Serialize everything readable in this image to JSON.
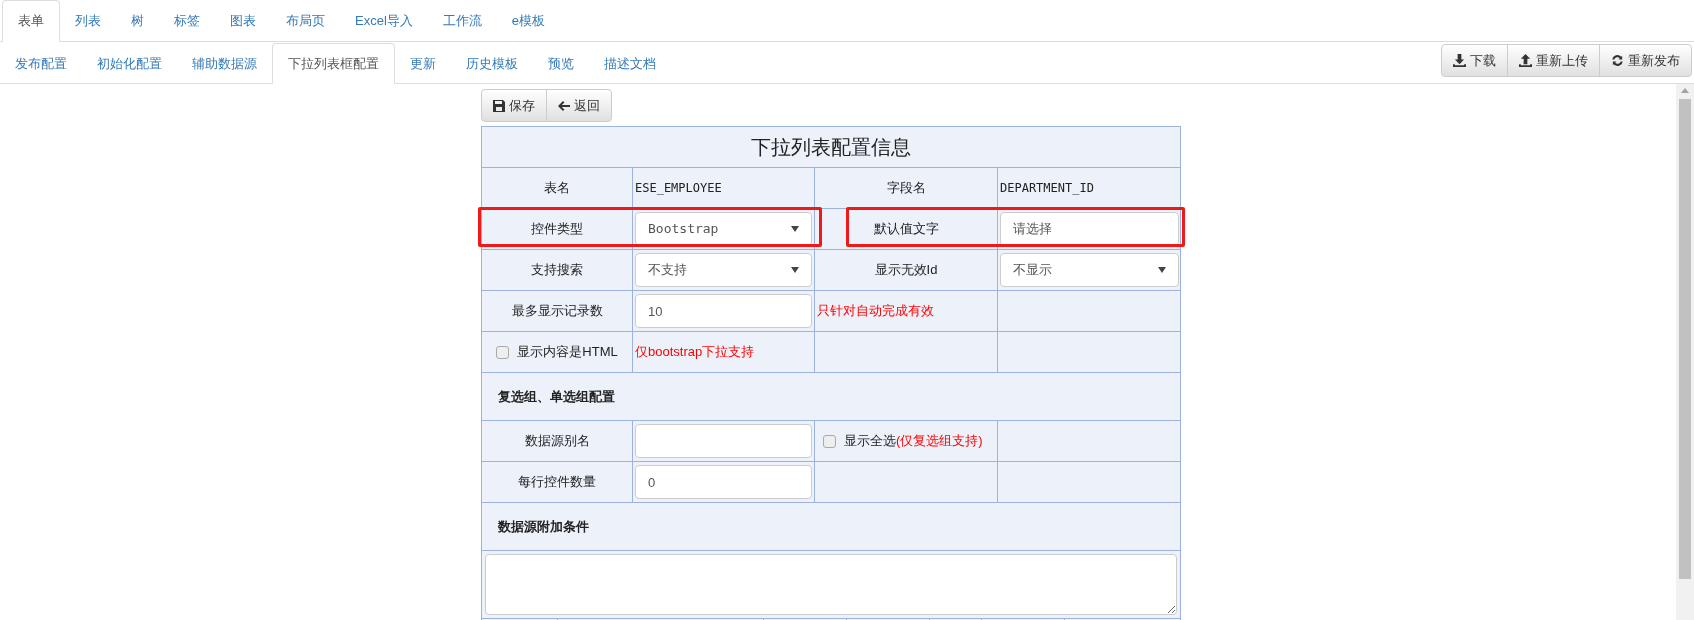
{
  "main_tabs": [
    {
      "label": "表单",
      "selected": true
    },
    {
      "label": "列表",
      "selected": false
    },
    {
      "label": "树",
      "selected": false
    },
    {
      "label": "标签",
      "selected": false
    },
    {
      "label": "图表",
      "selected": false
    },
    {
      "label": "布局页",
      "selected": false
    },
    {
      "label": "Excel导入",
      "selected": false
    },
    {
      "label": "工作流",
      "selected": false
    },
    {
      "label": "e模板",
      "selected": false
    }
  ],
  "sub_tabs": [
    {
      "label": "发布配置",
      "selected": false
    },
    {
      "label": "初始化配置",
      "selected": false
    },
    {
      "label": "辅助数据源",
      "selected": false
    },
    {
      "label": "下拉列表框配置",
      "selected": true
    },
    {
      "label": "更新",
      "selected": false
    },
    {
      "label": "历史模板",
      "selected": false
    },
    {
      "label": "预览",
      "selected": false
    },
    {
      "label": "描述文档",
      "selected": false
    }
  ],
  "toolbar": [
    {
      "kind": "download",
      "label": "下载"
    },
    {
      "kind": "upload",
      "label": "重新上传"
    },
    {
      "kind": "refresh",
      "label": "重新发布"
    }
  ],
  "form_buttons": [
    {
      "kind": "save",
      "label": "保存"
    },
    {
      "kind": "back",
      "label": "返回"
    }
  ],
  "form": {
    "title": "下拉列表配置信息",
    "rows": [
      {
        "kind": "cells",
        "cells": [
          {
            "kind": "label",
            "text": "表名"
          },
          {
            "kind": "text",
            "text": "ESE_EMPLOYEE"
          },
          {
            "kind": "label",
            "text": "字段名"
          },
          {
            "kind": "text",
            "text": "DEPARTMENT_ID"
          }
        ]
      },
      {
        "kind": "cells",
        "cells": [
          {
            "kind": "label",
            "text": "控件类型",
            "highlighted": true
          },
          {
            "kind": "select",
            "value": "Bootstrap"
          },
          {
            "kind": "label",
            "text": "默认值文字",
            "highlighted": true
          },
          {
            "kind": "input",
            "value": "请选择"
          }
        ]
      },
      {
        "kind": "cells",
        "cells": [
          {
            "kind": "label",
            "text": "支持搜索",
            "highlighted": false
          },
          {
            "kind": "select",
            "value": "不支持"
          },
          {
            "kind": "label",
            "text": "显示无效Id",
            "highlighted": false
          },
          {
            "kind": "select",
            "value": "不显示"
          }
        ]
      },
      {
        "kind": "cells",
        "cells": [
          {
            "kind": "label",
            "text": "最多显示记录数",
            "highlighted": false
          },
          {
            "kind": "input",
            "value": "10"
          },
          {
            "kind": "note",
            "text": "只针对自动完成有效"
          },
          {
            "kind": "empty"
          }
        ]
      },
      {
        "kind": "cells",
        "cells": [
          {
            "kind": "checkbox",
            "text": "显示内容是HTML",
            "checked": false
          },
          {
            "kind": "note",
            "text": "仅bootstrap下拉支持"
          },
          {
            "kind": "empty"
          },
          {
            "kind": "empty"
          }
        ]
      },
      {
        "kind": "section",
        "text": "复选组、单选组配置"
      },
      {
        "kind": "cells",
        "cells": [
          {
            "kind": "label",
            "text": "数据源别名",
            "highlighted": false
          },
          {
            "kind": "input"
          },
          {
            "kind": "checkbox",
            "text": "显示全选",
            "note": "(仅复选组支持)",
            "checked": false
          },
          {
            "kind": "empty"
          }
        ]
      },
      {
        "kind": "cells",
        "cells": [
          {
            "kind": "label",
            "text": "每行控件数量",
            "highlighted": false
          },
          {
            "kind": "input",
            "value": "0"
          },
          {
            "kind": "empty"
          },
          {
            "kind": "empty"
          }
        ]
      },
      {
        "kind": "section",
        "text": "数据源附加条件"
      },
      {
        "kind": "textarea"
      }
    ]
  }
}
